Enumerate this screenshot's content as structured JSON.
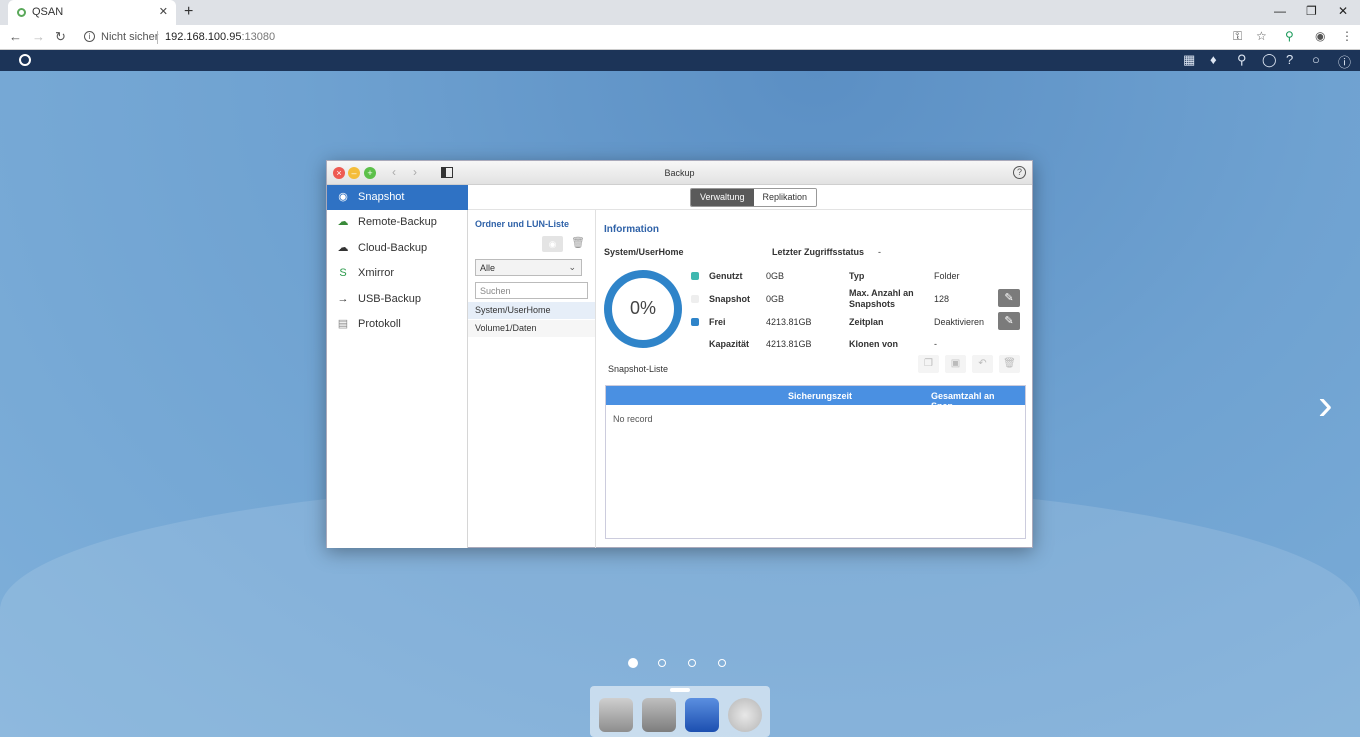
{
  "browser": {
    "tab_title": "QSAN",
    "tab_close": "✕",
    "new_tab": "+",
    "not_secure": "Nicht sicher",
    "url_host": "192.168.100.95",
    "url_port": ":13080"
  },
  "window": {
    "title": "Backup",
    "help": "?"
  },
  "sidebar": {
    "items": [
      {
        "label": "Snapshot",
        "icon": "camera-icon"
      },
      {
        "label": "Remote-Backup",
        "icon": "remote-backup-icon"
      },
      {
        "label": "Cloud-Backup",
        "icon": "cloud-icon"
      },
      {
        "label": "Xmirror",
        "icon": "xmirror-icon"
      },
      {
        "label": "USB-Backup",
        "icon": "usb-icon"
      },
      {
        "label": "Protokoll",
        "icon": "log-icon"
      }
    ]
  },
  "tabs": {
    "management": "Verwaltung",
    "replication": "Replikation"
  },
  "list_pane": {
    "title": "Ordner und LUN-Liste",
    "filter_value": "Alle",
    "search_placeholder": "Suchen",
    "items": [
      "System/UserHome",
      "Volume1/Daten"
    ]
  },
  "info": {
    "title": "Information",
    "path": "System/UserHome",
    "last_access_label": "Letzter Zugriffsstatus",
    "last_access_value": "-",
    "usage_percent": "0%",
    "used_label": "Genutzt",
    "used_value": "0GB",
    "snapshot_label": "Snapshot",
    "snapshot_value": "0GB",
    "free_label": "Frei",
    "free_value": "4213.81GB",
    "capacity_label": "Kapazität",
    "capacity_value": "4213.81GB",
    "type_label": "Typ",
    "type_value": "Folder",
    "max_snap_label_1": "Max. Anzahl an",
    "max_snap_label_2": "Snapshots",
    "max_snap_value": "128",
    "schedule_label": "Zeitplan",
    "schedule_value": "Deaktivieren",
    "clone_label": "Klonen von",
    "clone_value": "-"
  },
  "snapshot_list": {
    "title": "Snapshot-Liste",
    "col_time": "Sicherungszeit",
    "col_total": "Gesamtzahl an Snap...",
    "empty": "No record"
  },
  "colors": {
    "used": "#3fb8b0",
    "snapshot": "#eeeeee",
    "free": "#2f84c9",
    "accent": "#2f72c4"
  }
}
